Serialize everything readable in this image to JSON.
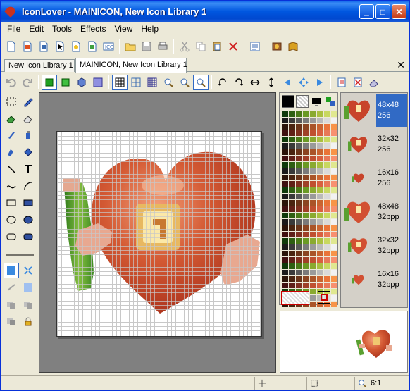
{
  "window": {
    "title": "IconLover - MAINICON, New Icon Library 1"
  },
  "titlebar_buttons": {
    "minimize": "_",
    "maximize": "□",
    "close": "✕"
  },
  "menu": [
    "File",
    "Edit",
    "Tools",
    "Effects",
    "View",
    "Help"
  ],
  "tabs": [
    {
      "label": "New Icon Library 1",
      "active": false
    },
    {
      "label": "MAINICON, New Icon Library 1",
      "active": true
    }
  ],
  "tab_close": "✕",
  "formats": [
    {
      "size": "48x48",
      "colors": "256",
      "selected": true
    },
    {
      "size": "32x32",
      "colors": "256",
      "selected": false
    },
    {
      "size": "16x16",
      "colors": "256",
      "selected": false
    },
    {
      "size": "48x48",
      "colors": "32bpp",
      "selected": false
    },
    {
      "size": "32x32",
      "colors": "32bpp",
      "selected": false
    },
    {
      "size": "16x16",
      "colors": "32bpp",
      "selected": false
    }
  ],
  "status": {
    "zoom": "6:1"
  },
  "colors": {
    "accent": "#316ac5",
    "heart": "#c8442a",
    "title_bar": "#0054e3"
  }
}
